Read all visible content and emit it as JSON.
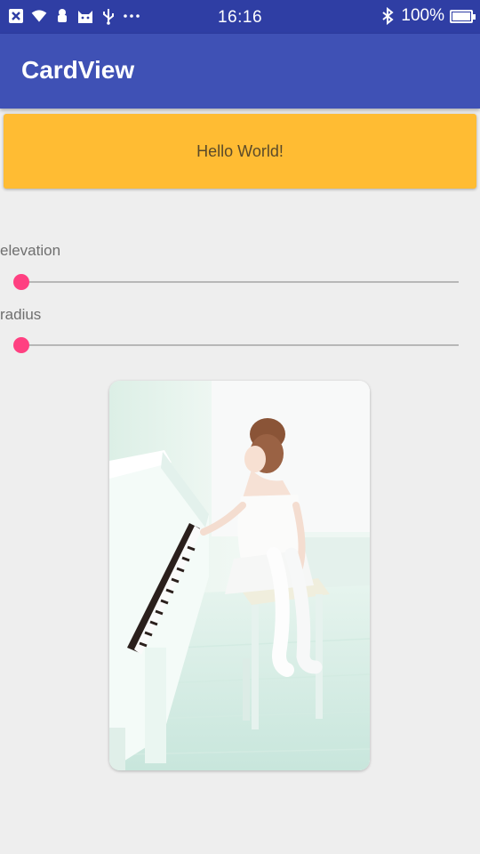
{
  "status_bar": {
    "time": "16:16",
    "battery_text": "100%",
    "icons_left": [
      "notification-x-icon",
      "wifi-icon",
      "android-robot-icon",
      "android-cat-icon",
      "usb-icon",
      "more-dots-icon"
    ],
    "icons_right": [
      "bluetooth-icon",
      "battery-icon"
    ]
  },
  "app_bar": {
    "title": "CardView"
  },
  "hello_card": {
    "text": "Hello World!"
  },
  "controls": {
    "elevation": {
      "label": "elevation",
      "value": 0
    },
    "radius": {
      "label": "radius",
      "value": 0
    }
  },
  "image_card": {
    "alt": "girl-playing-piano-photo"
  },
  "colors": {
    "status_bar": "#2f3ea4",
    "app_bar": "#3f51b5",
    "hello_card": "#ffbc33",
    "accent": "#ff4081",
    "background": "#eeeeee"
  }
}
